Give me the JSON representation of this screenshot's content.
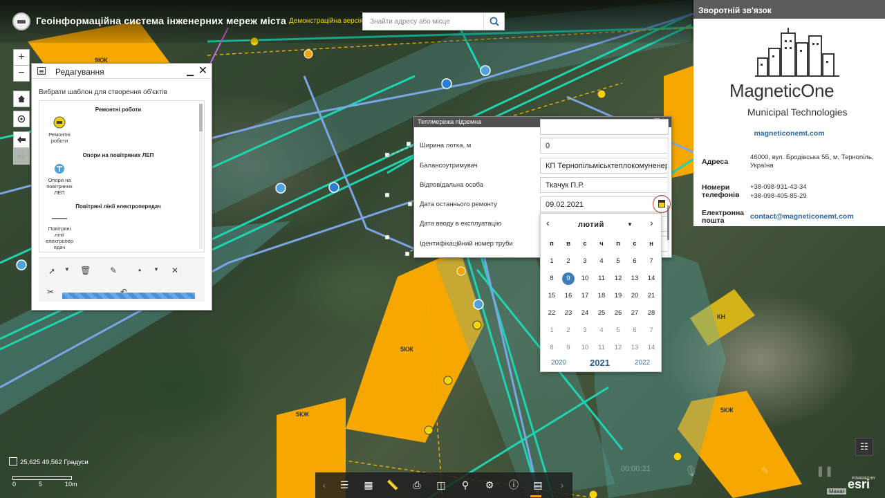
{
  "header": {
    "title": "Геоінформаційна система інженерних мереж міста",
    "demo_label": "Демонстраційна версія",
    "search_placeholder": "Знайти адресу або місце"
  },
  "map_controls": {
    "zoom_in": "+",
    "zoom_out": "−"
  },
  "map_labels": {
    "b1": "9КЖ",
    "b2": "5КЖ",
    "b3": "5КЖ",
    "b4": "КН",
    "b5": "5КЖ"
  },
  "edit_panel": {
    "title": "Редагування",
    "caption": "Вибрати шаблон для створення об'єктів",
    "groups": [
      {
        "title": "Ремонтні роботи",
        "item": "Ремонтні роботи"
      },
      {
        "title": "Опори на повітряних ЛЕП",
        "item": "Опори на повітряних ЛЕП"
      },
      {
        "title": "Повітряні лінії електропередач",
        "item": "Повітряні лінії електропер едач"
      }
    ]
  },
  "popup": {
    "title": "Теплмережа підземна",
    "rows": [
      {
        "label": "Ширина лотка, м",
        "value": "0"
      },
      {
        "label": "Балансоутримувач",
        "value": "КП Тернопільміськтеплокомуненергія"
      },
      {
        "label": "Відповідальна особа",
        "value": "Ткачук П.Р."
      },
      {
        "label": "Дата останнього ремонту",
        "value": "09.02.2021"
      },
      {
        "label": "Дата вводу в експлуатацію",
        "value": ""
      },
      {
        "label": "Ідентифікаційний номер труби",
        "value": ""
      }
    ]
  },
  "datepicker": {
    "month": "лютий",
    "weekdays": [
      "п",
      "в",
      "с",
      "ч",
      "п",
      "с",
      "н"
    ],
    "weeks": [
      [
        "1",
        "2",
        "3",
        "4",
        "5",
        "6",
        "7"
      ],
      [
        "8",
        "9",
        "10",
        "11",
        "12",
        "13",
        "14"
      ],
      [
        "15",
        "16",
        "17",
        "18",
        "19",
        "20",
        "21"
      ],
      [
        "22",
        "23",
        "24",
        "25",
        "26",
        "27",
        "28"
      ],
      [
        "1",
        "2",
        "3",
        "4",
        "5",
        "6",
        "7"
      ],
      [
        "8",
        "9",
        "10",
        "11",
        "12",
        "13",
        "14"
      ]
    ],
    "selected": "9",
    "years": [
      "2020",
      "2021",
      "2022"
    ]
  },
  "contact": {
    "header": "Зворотній зв'язок",
    "brand": "MagneticOne",
    "brand_sub": "Municipal Technologies",
    "site": "magneticonemt.com",
    "address_label": "Адреса",
    "address": "46000, вул. Бродівська 5Б, м. Тернопіль, Україна",
    "phones_label": "Номери телефонів",
    "phone1": "+38-098-931-43-34",
    "phone2": "+38-098-405-85-29",
    "email_label": "Електронна пошта",
    "email": "contact@magneticonemt.com"
  },
  "status": {
    "coords": "25,625 49,562 Градуси",
    "scale": [
      "0",
      "5",
      "10m"
    ],
    "video_time": "00:00:21",
    "maxar": "Maxar",
    "esri": "esri",
    "esri_powered": "POWERED BY"
  },
  "colors": {
    "accent": "#3d7db8",
    "building": "#f6a800",
    "network": "#1fd4b0",
    "pipe": "#7aa6e8"
  }
}
